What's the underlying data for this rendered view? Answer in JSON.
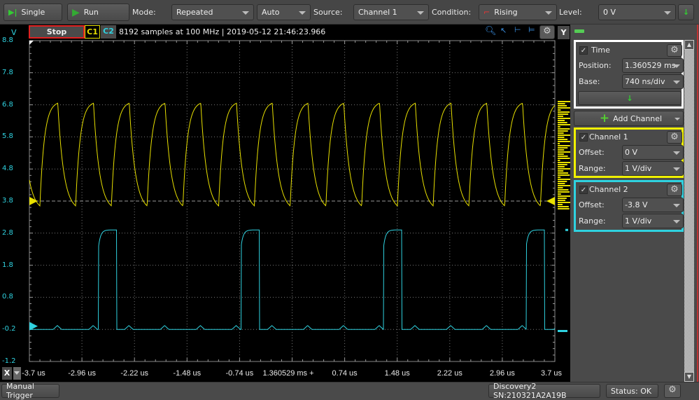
{
  "toolbar": {
    "single_label": "Single",
    "run_label": "Run",
    "mode_label": "Mode:",
    "mode_value": "Repeated",
    "auto_value": "Auto",
    "source_label": "Source:",
    "source_value": "Channel 1",
    "condition_label": "Condition:",
    "condition_value": "Rising",
    "level_label": "Level:",
    "level_value": "0 V"
  },
  "plot": {
    "stop_label": "Stop",
    "c1_label": "C1",
    "c2_label": "C2",
    "info": "8192 samples at 100 MHz | 2019-05-12 21:46:23.966",
    "y_unit": "V",
    "y_button": "Y",
    "x_button": "X",
    "y_ticks": [
      "8.8",
      "7.8",
      "6.8",
      "5.8",
      "4.8",
      "3.8",
      "2.8",
      "1.8",
      "0.8",
      "-0.2",
      "-1.2"
    ],
    "x_ticks": [
      "-3.7 us",
      "-2.96 us",
      "-2.22 us",
      "-1.48 us",
      "-0.74 us",
      "1.360529 ms +",
      "0.74 us",
      "1.48 us",
      "2.22 us",
      "2.96 us",
      "3.7 us"
    ],
    "colors": {
      "ch1": "#e8e000",
      "ch2": "#2fd2e0",
      "grid": "#777777"
    }
  },
  "panel": {
    "time": {
      "title": "Time",
      "position_label": "Position:",
      "position_value": "1.360529 ms",
      "base_label": "Base:",
      "base_value": "740 ns/div"
    },
    "add_channel": "Add Channel",
    "channel1": {
      "title": "Channel 1",
      "offset_label": "Offset:",
      "offset_value": "0 V",
      "range_label": "Range:",
      "range_value": "1 V/div"
    },
    "channel2": {
      "title": "Channel 2",
      "offset_label": "Offset:",
      "offset_value": "-3.8 V",
      "range_label": "Range:",
      "range_value": "1 V/div"
    }
  },
  "status": {
    "manual_trigger": "Manual Trigger",
    "device": "Discovery2 SN:210321A2A19B",
    "status": "Status: OK"
  }
}
